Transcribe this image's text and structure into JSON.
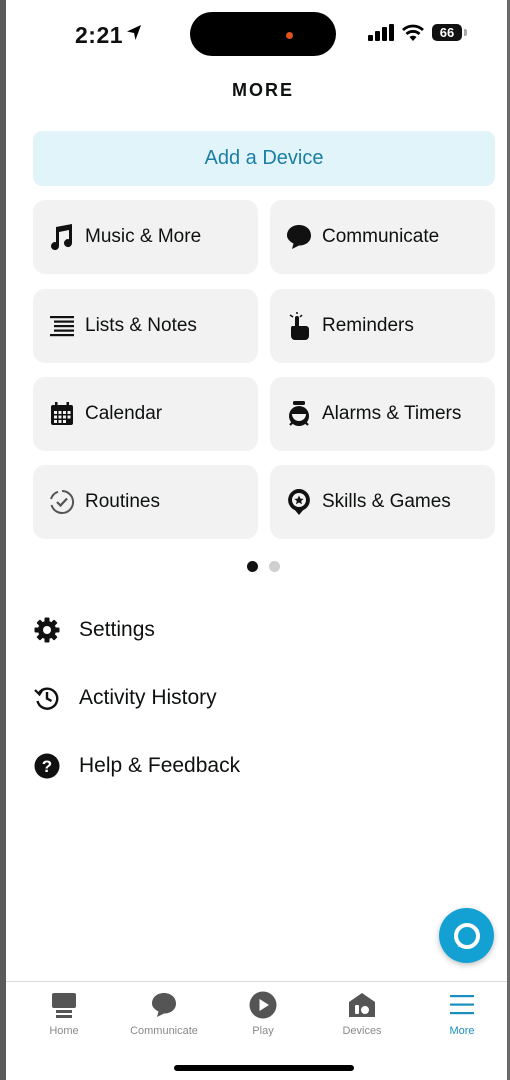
{
  "status_bar": {
    "time": "2:21",
    "battery": "66"
  },
  "header": {
    "title": "MORE"
  },
  "add_device": {
    "label": "Add a Device"
  },
  "tiles": [
    {
      "label": "Music & More",
      "icon": "music-note-icon"
    },
    {
      "label": "Communicate",
      "icon": "chat-bubble-icon"
    },
    {
      "label": "Lists & Notes",
      "icon": "list-icon"
    },
    {
      "label": "Reminders",
      "icon": "reminder-hand-icon"
    },
    {
      "label": "Calendar",
      "icon": "calendar-icon"
    },
    {
      "label": "Alarms & Timers",
      "icon": "alarm-clock-icon"
    },
    {
      "label": "Routines",
      "icon": "routines-icon"
    },
    {
      "label": "Skills & Games",
      "icon": "skills-badge-icon"
    }
  ],
  "pager": {
    "pages": 2,
    "current": 1
  },
  "menu": [
    {
      "label": "Settings",
      "icon": "gear-icon"
    },
    {
      "label": "Activity History",
      "icon": "history-icon"
    },
    {
      "label": "Help & Feedback",
      "icon": "help-icon"
    }
  ],
  "tabs": [
    {
      "label": "Home",
      "icon": "home-icon"
    },
    {
      "label": "Communicate",
      "icon": "chat-bubble-icon"
    },
    {
      "label": "Play",
      "icon": "play-icon"
    },
    {
      "label": "Devices",
      "icon": "devices-icon"
    },
    {
      "label": "More",
      "icon": "menu-lines-icon",
      "active": true
    }
  ],
  "colors": {
    "accent": "#1a8fbf",
    "add_device_bg": "#e1f4fa",
    "tile_bg": "#f2f2f2",
    "alexa_blue": "#13a1d4"
  }
}
